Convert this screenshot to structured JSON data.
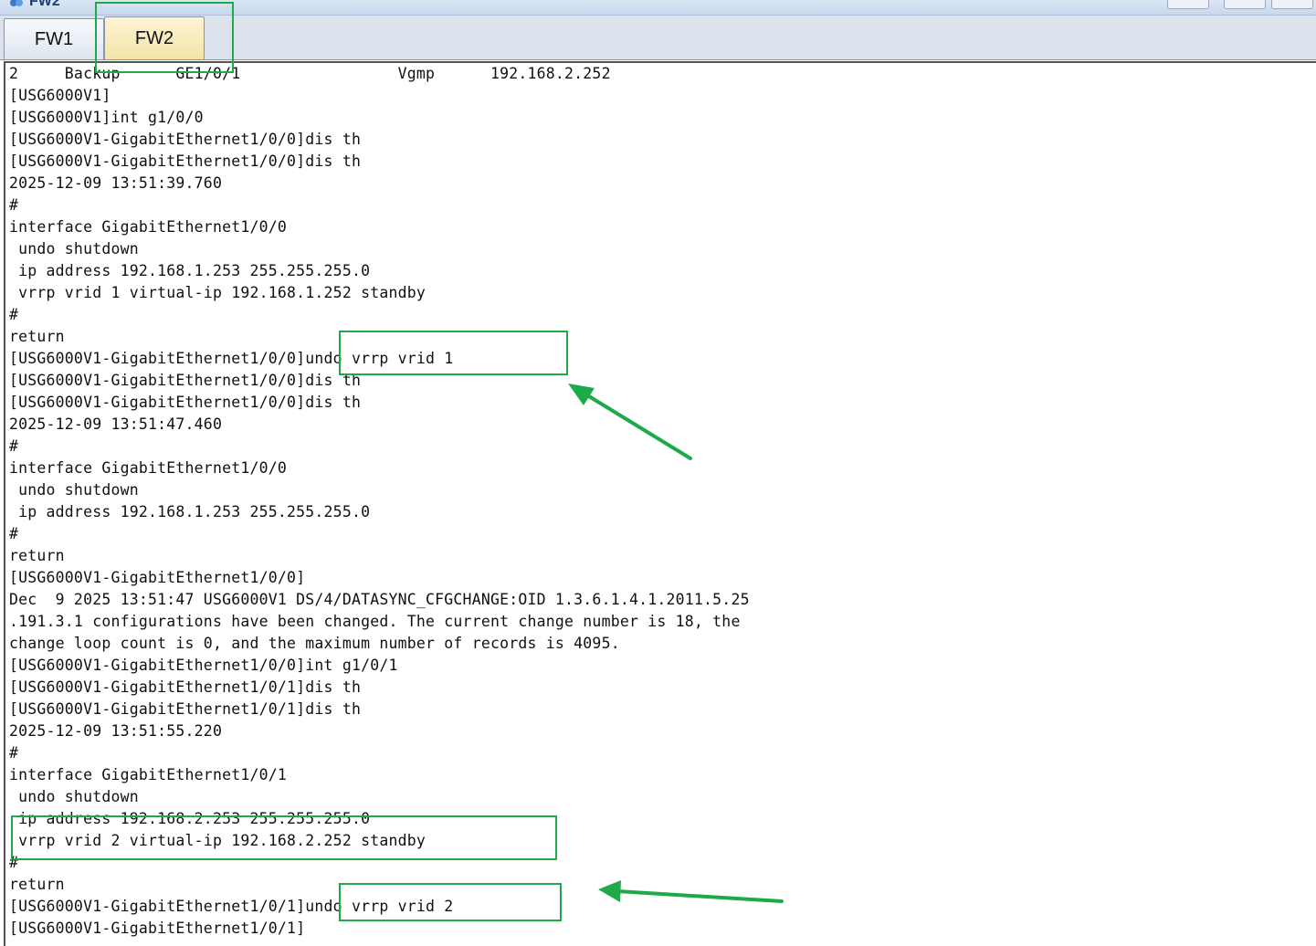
{
  "window": {
    "title": "FW2",
    "icon": "network-device-icon"
  },
  "tabs": [
    {
      "label": "FW1",
      "active": false
    },
    {
      "label": "FW2",
      "active": true
    }
  ],
  "terminal": {
    "lines": [
      "2     Backup      GE1/0/1                 Vgmp      192.168.2.252",
      "[USG6000V1]",
      "[USG6000V1]int g1/0/0",
      "[USG6000V1-GigabitEthernet1/0/0]dis th",
      "[USG6000V1-GigabitEthernet1/0/0]dis th",
      "2025-12-09 13:51:39.760",
      "#",
      "interface GigabitEthernet1/0/0",
      " undo shutdown",
      " ip address 192.168.1.253 255.255.255.0",
      " vrrp vrid 1 virtual-ip 192.168.1.252 standby",
      "#",
      "return",
      "[USG6000V1-GigabitEthernet1/0/0]undo vrrp vrid 1",
      "[USG6000V1-GigabitEthernet1/0/0]dis th",
      "[USG6000V1-GigabitEthernet1/0/0]dis th",
      "2025-12-09 13:51:47.460",
      "#",
      "interface GigabitEthernet1/0/0",
      " undo shutdown",
      " ip address 192.168.1.253 255.255.255.0",
      "#",
      "return",
      "[USG6000V1-GigabitEthernet1/0/0]",
      "Dec  9 2025 13:51:47 USG6000V1 DS/4/DATASYNC_CFGCHANGE:OID 1.3.6.1.4.1.2011.5.25",
      ".191.3.1 configurations have been changed. The current change number is 18, the",
      "change loop count is 0, and the maximum number of records is 4095.",
      "[USG6000V1-GigabitEthernet1/0/0]int g1/0/1",
      "[USG6000V1-GigabitEthernet1/0/1]dis th",
      "[USG6000V1-GigabitEthernet1/0/1]dis th",
      "2025-12-09 13:51:55.220",
      "#",
      "interface GigabitEthernet1/0/1",
      " undo shutdown",
      " ip address 192.168.2.253 255.255.255.0",
      " vrrp vrid 2 virtual-ip 192.168.2.252 standby",
      "#",
      "return",
      "[USG6000V1-GigabitEthernet1/0/1]undo vrrp vrid 2",
      "[USG6000V1-GigabitEthernet1/0/1]"
    ]
  },
  "annotations": {
    "highlight_color": "#1faa4a",
    "highlight_targets": [
      "tab FW2",
      "undo vrrp vrid 1",
      "vrrp vrid 2 virtual-ip 192.168.2.252 standby",
      "undo vrrp vrid 2"
    ],
    "arrow_targets": [
      "undo vrrp vrid 1",
      "undo vrrp vrid 2"
    ]
  }
}
